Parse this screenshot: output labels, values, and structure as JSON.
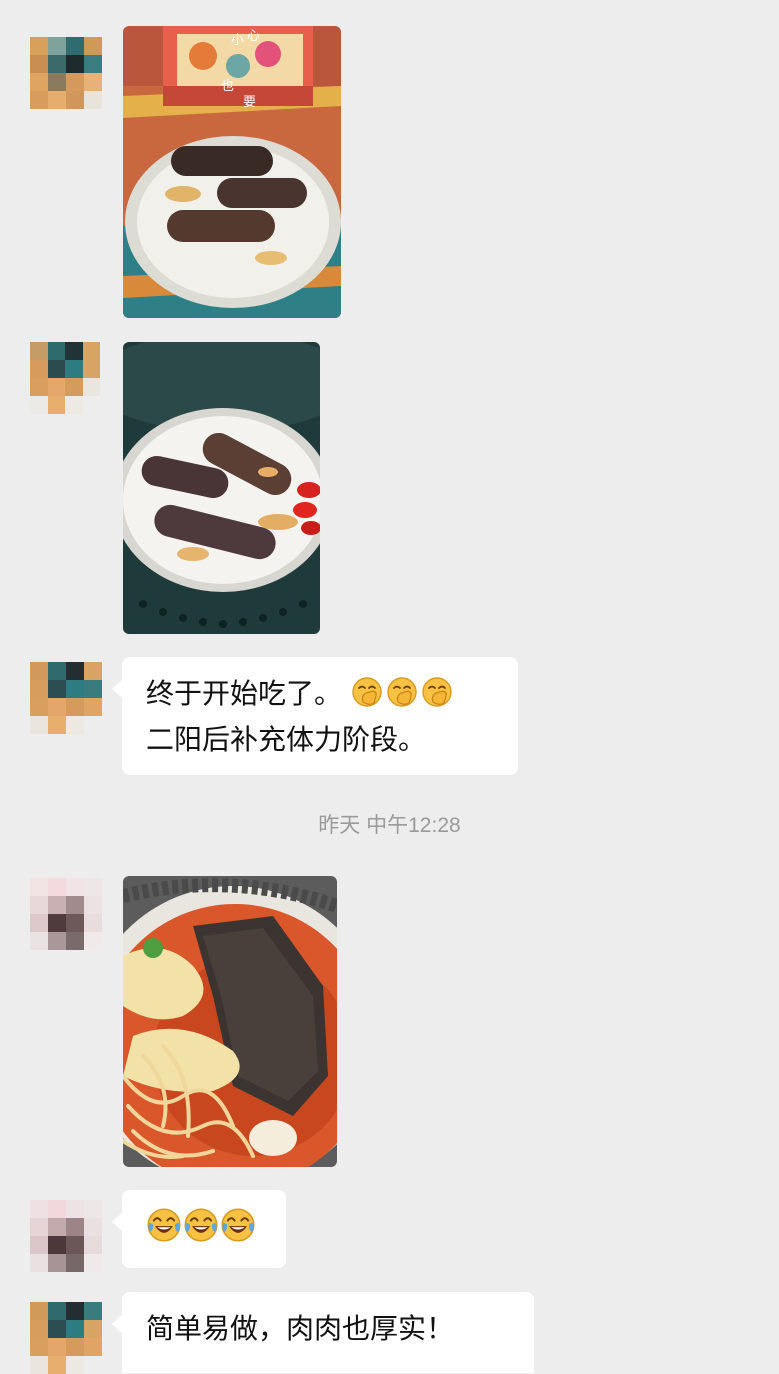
{
  "messages": {
    "text1": {
      "line1": "终于开始吃了。",
      "line2": "二阳后补充体力阶段。",
      "emoji": "grinning-hand-over-mouth-emoji",
      "emoji_count": 3
    },
    "timestamp": "昨天 中午12:28",
    "text2": {
      "emoji": "tears-of-joy-emoji",
      "emoji_count": 3
    },
    "text3": {
      "line1": "简单易做，肉肉也厚实！"
    }
  },
  "colors": {
    "background": "#ededed",
    "bubble": "#ffffff",
    "timestamp": "#9a9a9a"
  }
}
